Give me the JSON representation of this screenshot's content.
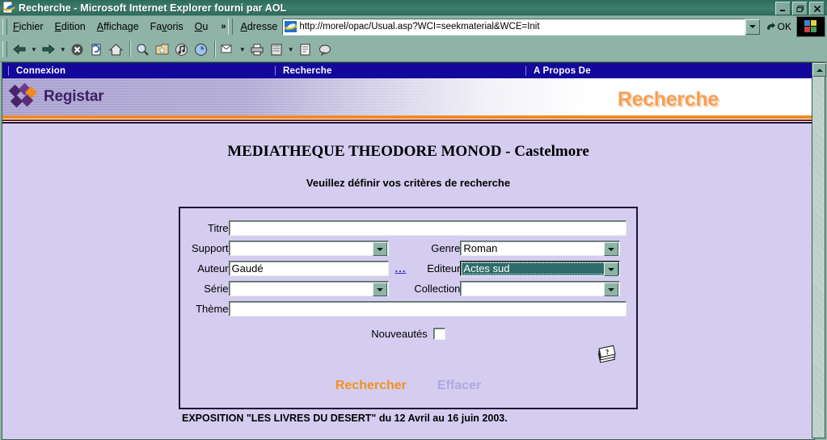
{
  "window": {
    "title": "Recherche - Microsoft Internet Explorer fourni par AOL",
    "app_icon": "ie-document-icon",
    "minimize": "_",
    "restore": "❐",
    "close": "✕"
  },
  "menu": {
    "items": [
      {
        "label": "Fichier",
        "accel": "F"
      },
      {
        "label": "Edition",
        "accel": "E"
      },
      {
        "label": "Affichage",
        "accel": "A"
      },
      {
        "label": "Favoris",
        "accel": "v"
      },
      {
        "label": "Ou",
        "accel": "O"
      }
    ],
    "overflow": "»"
  },
  "address": {
    "label": "Adresse",
    "icon": "ie-page-icon",
    "url": "http://morel/opac/Usual.asp?WCI=seekmaterial&WCE=Init",
    "dropdown_icon": "chevron-down-icon",
    "go_label": "OK",
    "go_icon": "go-arrow-icon",
    "brand_icon": "ie-logo-icon"
  },
  "toolbar": {
    "buttons": [
      {
        "name": "back-button",
        "glyph": "⇐"
      },
      {
        "name": "back-dropdown",
        "glyph": "▾"
      },
      {
        "name": "forward-button",
        "glyph": "⇒"
      },
      {
        "name": "forward-dropdown",
        "glyph": "▾"
      },
      {
        "name": "stop-button",
        "glyph": "⊗"
      },
      {
        "name": "refresh-button",
        "glyph": "↻"
      },
      {
        "name": "home-button",
        "glyph": "⌂"
      },
      {
        "name": "search-button",
        "glyph": "⌕"
      },
      {
        "name": "favorites-button",
        "glyph": "✳"
      },
      {
        "name": "media-button",
        "glyph": "♫"
      },
      {
        "name": "history-button",
        "glyph": "◔"
      },
      {
        "name": "mail-button",
        "glyph": "✉"
      },
      {
        "name": "mail-dropdown",
        "glyph": "▾"
      },
      {
        "name": "print-button",
        "glyph": "⎙"
      },
      {
        "name": "edit-button",
        "glyph": "▤"
      },
      {
        "name": "edit-dropdown",
        "glyph": "▾"
      },
      {
        "name": "discuss-button",
        "glyph": "☷"
      },
      {
        "name": "messenger-button",
        "glyph": "❦"
      }
    ]
  },
  "navbar": {
    "items": [
      {
        "label": "Connexion"
      },
      {
        "label": "Recherche"
      },
      {
        "label": "A Propos De"
      }
    ],
    "separator": "|"
  },
  "banner": {
    "logo_text": "Registar",
    "title": "Recherche",
    "logo_colors": [
      "#5b2d7a",
      "#4a2468",
      "#f08a20",
      "#6b3a8e"
    ],
    "accent_orange": "#f08a20",
    "accent_purple": "#7f76b5"
  },
  "page": {
    "title": "MEDIATHEQUE THEODORE MONOD - Castelmore",
    "subtitle": "Veuillez définir vos critères de recherche",
    "footer_note": "EXPOSITION \"LES LIVRES DU DESERT\" du 12 Avril au 16 juin 2003."
  },
  "form": {
    "titre": {
      "label": "Titre",
      "value": "",
      "type": "text"
    },
    "support": {
      "label": "Support",
      "value": "",
      "type": "select"
    },
    "genre": {
      "label": "Genre",
      "value": "Roman",
      "type": "select"
    },
    "auteur": {
      "label": "Auteur",
      "value": "Gaudé",
      "type": "text",
      "helper": "..."
    },
    "editeur": {
      "label": "Editeur",
      "value": "Actes sud",
      "type": "select",
      "focused": true
    },
    "serie": {
      "label": "Série",
      "value": "",
      "type": "select"
    },
    "collection": {
      "label": "Collection",
      "value": "",
      "type": "select"
    },
    "theme": {
      "label": "Thème",
      "value": "",
      "type": "text"
    },
    "nouveautes": {
      "label": "Nouveautés",
      "checked": false
    },
    "help_icon": "help-pages-icon",
    "submit": {
      "label": "Rechercher"
    },
    "reset": {
      "label": "Effacer"
    }
  },
  "colors": {
    "page_background": "#d5cdf0",
    "navbar_background": "#14089c",
    "chrome_background": "#8fb3a6",
    "titlebar": "#2d6b5c",
    "submit_text": "#f29120",
    "reset_text": "#b0a8e0",
    "focus_select_bg": "#2e6b6b"
  },
  "scrollbar": {
    "up_arrow": "▲"
  }
}
